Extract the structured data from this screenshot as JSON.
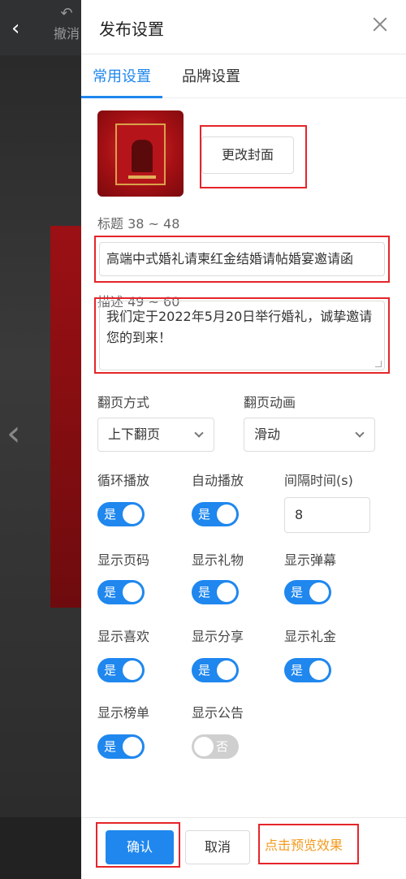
{
  "header": {
    "undo_label": "撤消"
  },
  "panel": {
    "title": "发布设置",
    "tabs": [
      {
        "label": "常用设置",
        "active": true
      },
      {
        "label": "品牌设置",
        "active": false
      }
    ],
    "change_cover_label": "更改封面",
    "title_field": {
      "label": "标题 38 ~ 48",
      "value": "高端中式婚礼请柬红金结婚请帖婚宴邀请函"
    },
    "desc_field": {
      "label": "描述 49 ~ 60",
      "value": "我们定于2022年5月20日举行婚礼，诚挚邀请您的到来！"
    },
    "page_mode": {
      "label": "翻页方式",
      "value": "上下翻页"
    },
    "page_anim": {
      "label": "翻页动画",
      "value": "滑动"
    },
    "loop": {
      "label": "循环播放",
      "state": "是",
      "on": true
    },
    "autoplay": {
      "label": "自动播放",
      "state": "是",
      "on": true
    },
    "interval": {
      "label": "间隔时间(s)",
      "value": "8"
    },
    "show_page_num": {
      "label": "显示页码",
      "state": "是",
      "on": true
    },
    "show_gift": {
      "label": "显示礼物",
      "state": "是",
      "on": true
    },
    "show_danmaku": {
      "label": "显示弹幕",
      "state": "是",
      "on": true
    },
    "show_like": {
      "label": "显示喜欢",
      "state": "是",
      "on": true
    },
    "show_share": {
      "label": "显示分享",
      "state": "是",
      "on": true
    },
    "show_money": {
      "label": "显示礼金",
      "state": "是",
      "on": true
    },
    "show_rank": {
      "label": "显示榜单",
      "state": "是",
      "on": true
    },
    "show_notice": {
      "label": "显示公告",
      "state": "否",
      "on": false
    }
  },
  "footer": {
    "confirm_label": "确认",
    "cancel_label": "取消",
    "preview_label": "点击预览效果"
  },
  "colors": {
    "accent": "#1f87ee",
    "highlight": "#e5252a",
    "preview": "#f39a1e"
  }
}
